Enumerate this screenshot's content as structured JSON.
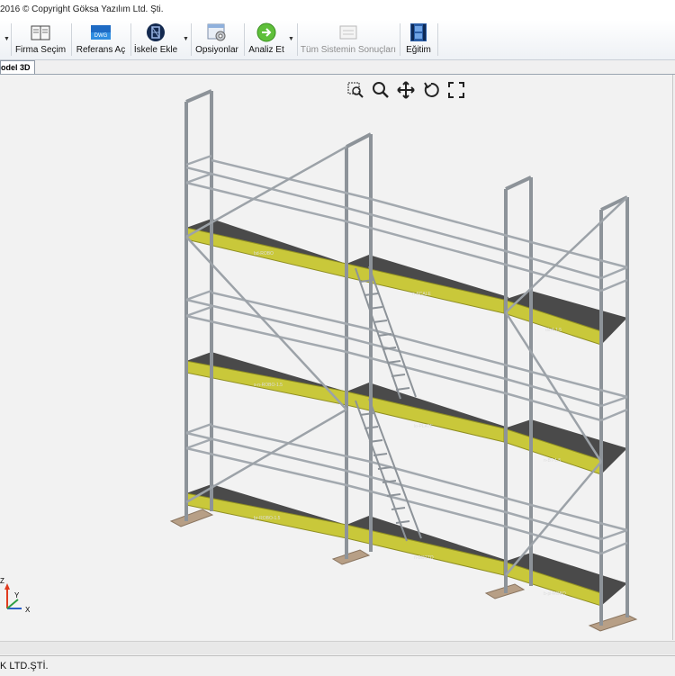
{
  "window": {
    "title": "2016  © Copyright Göksa Yazılım Ltd. Şti."
  },
  "toolbar": {
    "buttons": [
      {
        "label": "Firma Seçim",
        "icon": "book-icon"
      },
      {
        "label": "Referans Aç",
        "icon": "reference-icon"
      },
      {
        "label": "İskele Ekle",
        "icon": "scaffold-icon"
      },
      {
        "label": "Opsiyonlar",
        "icon": "options-icon"
      },
      {
        "label": "Analiz Et",
        "icon": "analyze-icon"
      },
      {
        "label": "Tüm Sistemin Sonuçları",
        "icon": "results-icon"
      },
      {
        "label": "Eğitim",
        "icon": "film-icon"
      }
    ],
    "reference_badge": "DWG"
  },
  "tabs": {
    "active": "odel 3D"
  },
  "viewport_tools": [
    "zoom-window-icon",
    "zoom-icon",
    "pan-icon",
    "rotate-icon",
    "fit-screen-icon"
  ],
  "axes": {
    "x": "X",
    "y": "Y",
    "z": "Z"
  },
  "platform_labels": [
    "bd-ROBO",
    "n-SCALE",
    "din4-1.5",
    "s-n-ROBO-1.5",
    "n-BT-1.5",
    "lo-PLATE",
    "br-ROBO-1.5",
    "n-BOTTO",
    "b-pl-ROBO"
  ],
  "status": {
    "text": "K LTD.ŞTİ."
  },
  "colors": {
    "platform": "#c9c83a",
    "deck": "#4a4a4a",
    "pipe": "#9aa0a6",
    "baseplate": "#b79f86"
  }
}
